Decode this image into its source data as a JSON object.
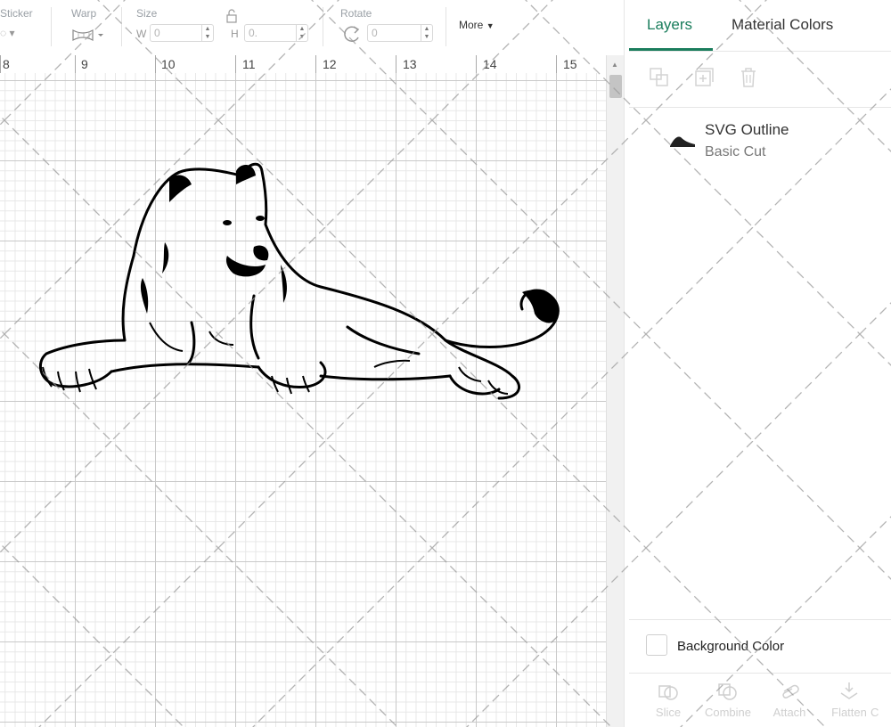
{
  "toolbar": {
    "sticker_label": "Sticker",
    "warp_label": "Warp",
    "size_label": "Size",
    "width_prefix": "W",
    "width_value": "0",
    "height_prefix": "H",
    "height_value": "0.",
    "rotate_label": "Rotate",
    "rotate_value": "0",
    "more_label": "More"
  },
  "ruler": {
    "numbers": [
      "8",
      "9",
      "10",
      "11",
      "12",
      "13",
      "14",
      "15"
    ]
  },
  "panel": {
    "tabs": [
      {
        "label": "Layers",
        "active": true
      },
      {
        "label": "Material Colors",
        "active": false
      }
    ],
    "layer": {
      "title": "SVG Outline",
      "subtitle": "Basic Cut"
    },
    "background_color_label": "Background Color",
    "bottom_tools": [
      "Slice",
      "Combine",
      "Attach",
      "Flatten",
      "C"
    ]
  },
  "colors": {
    "accent": "#1a7d5c",
    "grid_major": "#c9c9c9",
    "grid_minor": "#e7e7e7"
  }
}
